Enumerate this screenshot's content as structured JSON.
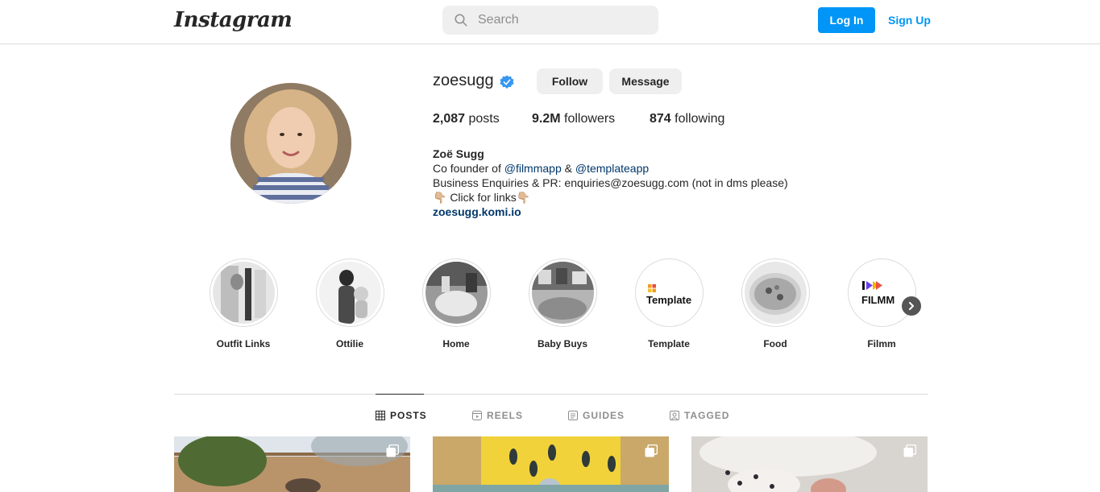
{
  "nav": {
    "logo": "Instagram",
    "search_placeholder": "Search",
    "login_label": "Log In",
    "signup_label": "Sign Up"
  },
  "profile": {
    "username": "zoesugg",
    "follow_label": "Follow",
    "message_label": "Message",
    "stats": {
      "posts_count": "2,087",
      "posts_label": "posts",
      "followers_count": "9.2M",
      "followers_label": "followers",
      "following_count": "874",
      "following_label": "following"
    },
    "bio": {
      "full_name": "Zoë Sugg",
      "line1_prefix": "Co founder of ",
      "mention1": "@filmmapp",
      "line1_amp": " & ",
      "mention2": "@templateapp",
      "line2": "Business Enquiries & PR: enquiries@zoesugg.com (not in dms please)",
      "line3": "👇🏼 Click for links👇🏼",
      "external_link": "zoesugg.komi.io"
    }
  },
  "highlights": [
    {
      "label": "Outfit Links"
    },
    {
      "label": "Ottilie"
    },
    {
      "label": "Home"
    },
    {
      "label": "Baby Buys"
    },
    {
      "label": "Template",
      "logo_text": "Template"
    },
    {
      "label": "Food"
    },
    {
      "label": "Filmm",
      "logo_text": "FILMM"
    }
  ],
  "tabs": [
    {
      "label": "POSTS",
      "icon": "grid-icon",
      "active": true
    },
    {
      "label": "REELS",
      "icon": "reels-icon",
      "active": false
    },
    {
      "label": "GUIDES",
      "icon": "guides-icon",
      "active": false
    },
    {
      "label": "TAGGED",
      "icon": "tagged-icon",
      "active": false
    }
  ],
  "colors": {
    "accent": "#0095f6",
    "link": "#00376b",
    "verified": "#3897f0"
  }
}
